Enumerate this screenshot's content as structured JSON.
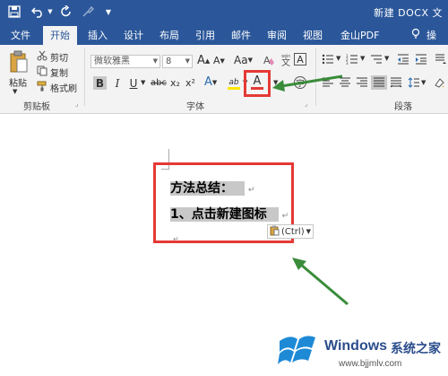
{
  "titlebar": {
    "title": "新建 DOCX 文",
    "quick_access": [
      "save-icon",
      "undo-icon",
      "redo-icon",
      "brush-icon",
      "customize-icon"
    ]
  },
  "tabs": [
    {
      "label": "文件"
    },
    {
      "label": "开始",
      "active": true
    },
    {
      "label": "插入"
    },
    {
      "label": "设计"
    },
    {
      "label": "布局"
    },
    {
      "label": "引用"
    },
    {
      "label": "邮件"
    },
    {
      "label": "审阅"
    },
    {
      "label": "视图"
    },
    {
      "label": "金山PDF"
    },
    {
      "label": "操"
    }
  ],
  "clipboard": {
    "paste": "粘贴",
    "cut": "剪切",
    "copy": "复制",
    "format_painter": "格式刷",
    "group_label": "剪贴板"
  },
  "font": {
    "font_name": "微软雅黑",
    "font_size": "8",
    "grow": "A",
    "shrink": "A",
    "case": "Aa",
    "bold": "B",
    "italic": "I",
    "underline": "U",
    "strike": "abc",
    "subscript": "x₂",
    "superscript": "x²",
    "effects": "A",
    "highlight": "ab",
    "font_color": "A",
    "group_label": "字体"
  },
  "paragraph": {
    "group_label": "段落"
  },
  "document": {
    "line1": "方法总结：",
    "line2": "1、点击新建图标",
    "paste_options": "(Ctrl)"
  },
  "watermark": {
    "brand": "Windows",
    "site_name": "系统之家",
    "url": "www.bjjmlv.com"
  },
  "colors": {
    "ribbon_blue": "#2b579a",
    "highlight_red": "#e53935",
    "arrow_green": "#3a8c3a",
    "font_color_red": "#e53935",
    "highlight_yellow": "#ffe600"
  }
}
